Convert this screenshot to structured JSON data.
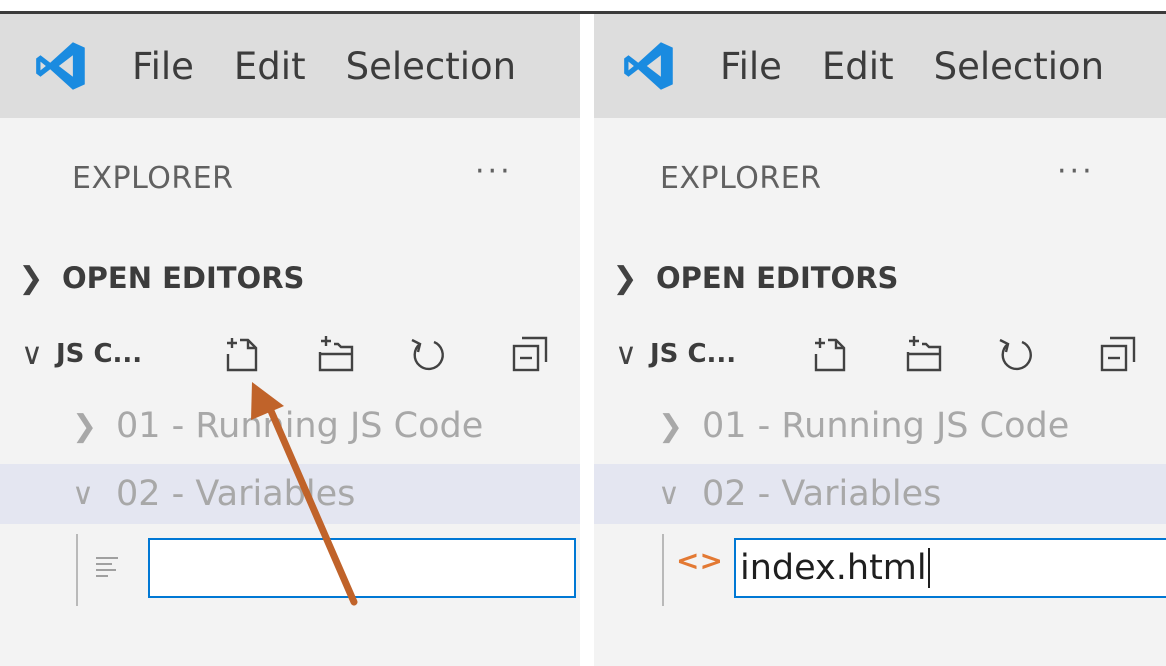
{
  "left_window": {
    "menu": {
      "file": "File",
      "edit": "Edit",
      "selection": "Selection"
    },
    "explorer": {
      "title": "EXPLORER",
      "more": "···",
      "open_editors": "OPEN EDITORS",
      "project": "JS C...",
      "toolbar_icons": [
        "new-file-icon",
        "new-folder-icon",
        "refresh-icon",
        "collapse-all-icon"
      ],
      "folders": [
        "01 - Running JS Code",
        "02 - Variables"
      ],
      "new_file_input": {
        "value": ""
      }
    }
  },
  "right_window": {
    "menu": {
      "file": "File",
      "edit": "Edit",
      "selection": "Selection"
    },
    "explorer": {
      "title": "EXPLORER",
      "more": "···",
      "open_editors": "OPEN EDITORS",
      "project": "JS C...",
      "toolbar_icons": [
        "new-file-icon",
        "new-folder-icon",
        "refresh-icon",
        "collapse-all-icon"
      ],
      "folders": [
        "01 - Running JS Code",
        "02 - Variables"
      ],
      "new_file_input": {
        "value": "index.html"
      }
    }
  },
  "colors": {
    "menubar": "#dddddd",
    "sidebar": "#f3f3f3",
    "selected_row": "#e4e6f1",
    "input_border": "#0078d4",
    "annotation_arrow": "#c0632a",
    "vscode_blue": "#1a8be0"
  }
}
